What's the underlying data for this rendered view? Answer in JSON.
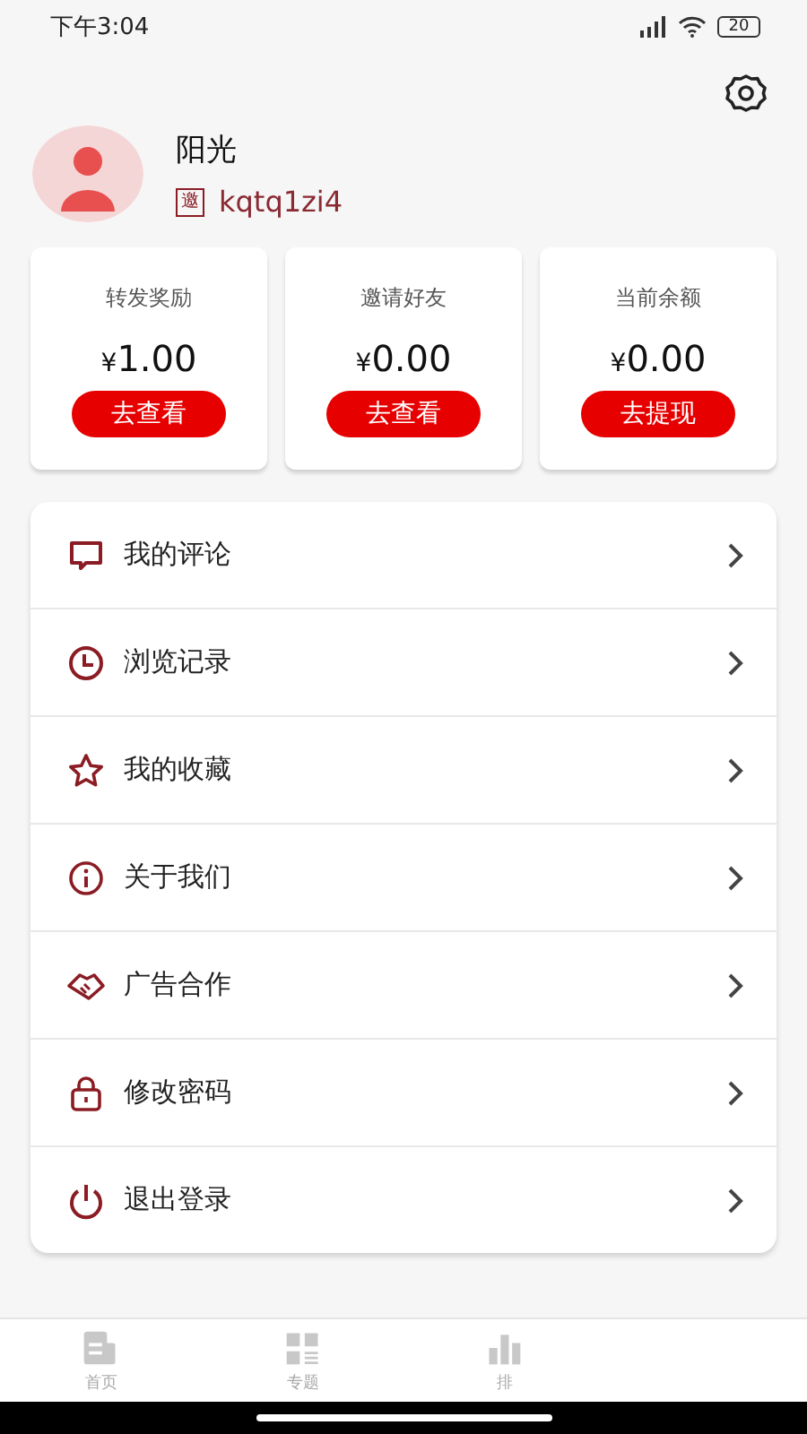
{
  "status_bar": {
    "time": "下午3:04",
    "battery": "20"
  },
  "profile": {
    "name": "阳光",
    "invite_badge": "邀",
    "invite_code": "kqtq1zi4"
  },
  "stats": [
    {
      "label": "转发奖励",
      "currency": "¥",
      "amount": "1.00",
      "button": "去查看"
    },
    {
      "label": "邀请好友",
      "currency": "¥",
      "amount": "0.00",
      "button": "去查看"
    },
    {
      "label": "当前余额",
      "currency": "¥",
      "amount": "0.00",
      "button": "去提现"
    }
  ],
  "menu": [
    {
      "kind": "comment",
      "label": "我的评论"
    },
    {
      "kind": "history",
      "label": "浏览记录"
    },
    {
      "kind": "star",
      "label": "我的收藏"
    },
    {
      "kind": "info",
      "label": "关于我们"
    },
    {
      "kind": "handshake",
      "label": "广告合作"
    },
    {
      "kind": "lock",
      "label": "修改密码"
    },
    {
      "kind": "power",
      "label": "退出登录"
    }
  ],
  "bottom_nav": [
    {
      "kind": "home",
      "label": "首页"
    },
    {
      "kind": "topics",
      "label": "专题"
    },
    {
      "kind": "ranking",
      "label": "排"
    }
  ]
}
